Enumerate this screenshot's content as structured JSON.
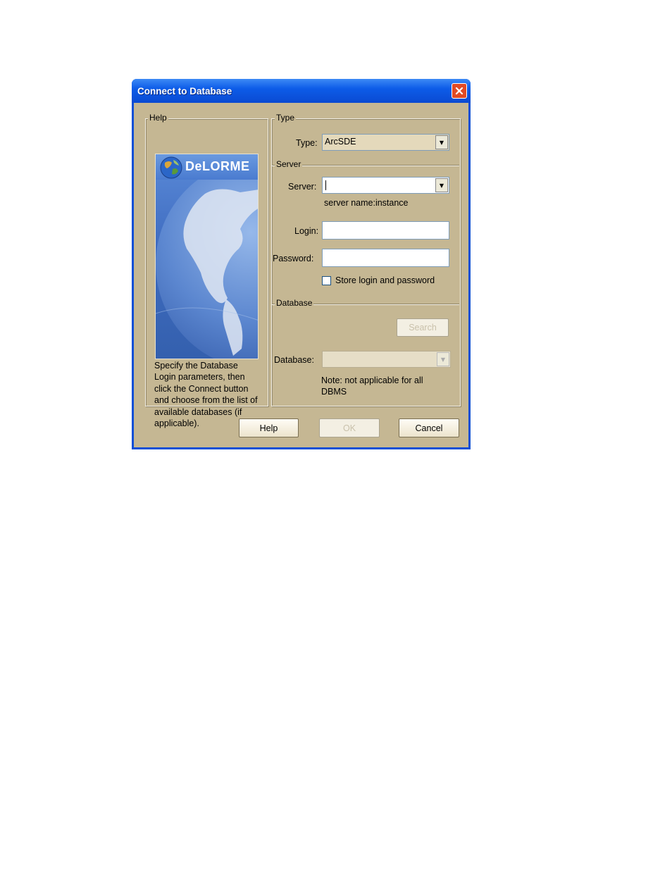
{
  "window": {
    "title": "Connect to Database"
  },
  "help": {
    "legend": "Help",
    "logo_text": "DeLORME",
    "text": "Specify the Database Login parameters, then click the Connect button and choose from the list of available databases (if applicable)."
  },
  "type_group": {
    "legend": "Type",
    "label": "Type:",
    "value": "ArcSDE"
  },
  "server_group": {
    "legend": "Server",
    "server_label": "Server:",
    "server_value": "",
    "server_hint": "server name:instance",
    "login_label": "Login:",
    "login_value": "",
    "password_label": "Password:",
    "password_value": "",
    "store_label": "Store login and password",
    "store_checked": false
  },
  "database_group": {
    "legend": "Database",
    "search_label": "Search",
    "database_label": "Database:",
    "database_value": "",
    "note": "Note: not applicable for all DBMS"
  },
  "buttons": {
    "help": "Help",
    "ok": "OK",
    "cancel": "Cancel"
  },
  "colors": {
    "title_bar": "#0a4fd6",
    "client": "#c5b793",
    "close": "#e14a24"
  }
}
